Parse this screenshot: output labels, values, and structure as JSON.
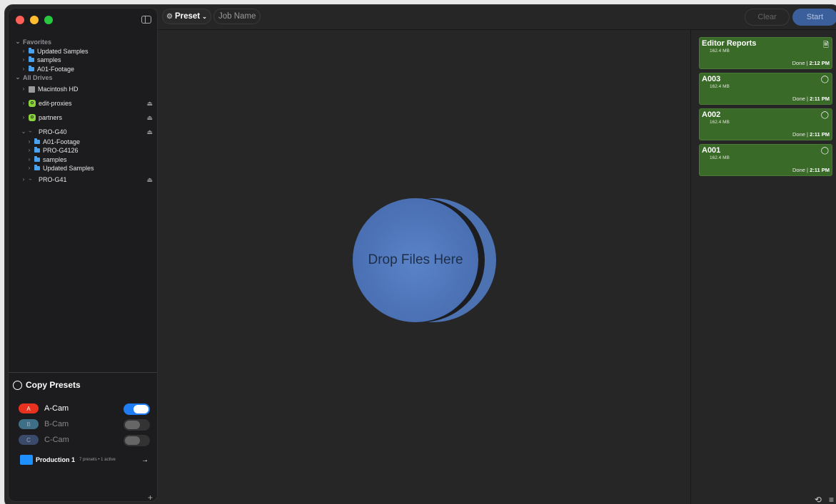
{
  "sidebar": {
    "favorites_label": "Favorites",
    "favorites": [
      "Updated Samples",
      "samples",
      "A01-Footage"
    ],
    "all_drives_label": "All Drives",
    "drives": {
      "macintosh": "Macintosh HD",
      "edit_proxies": "edit-proxies",
      "partners": "partners",
      "pro_g40": "PRO-G40",
      "pro_g40_children": [
        "A01-Footage",
        "PRO-G4126",
        "samples",
        "Updated Samples"
      ],
      "pro_g41": "PRO-G41"
    }
  },
  "presets": {
    "title": "Copy Presets",
    "cams": [
      {
        "badge": "A",
        "label": "A-Cam",
        "color": "#e8321f",
        "on": true
      },
      {
        "badge": "B",
        "label": "B-Cam",
        "color": "#3f6f86",
        "on": false
      },
      {
        "badge": "C",
        "label": "C-Cam",
        "color": "#3a4a6a",
        "on": false
      }
    ],
    "production": {
      "name": "Production 1",
      "meta": "7 presets • 1 active"
    }
  },
  "toolbar": {
    "preset_label": "Preset",
    "job_name_placeholder": "Job Name",
    "clear_label": "Clear",
    "start_label": "Start"
  },
  "drop_zone": {
    "label": "Drop Files Here"
  },
  "jobs": [
    {
      "name": "Editor Reports",
      "size": "162.4 MB",
      "status": "Done",
      "time": "2:12 PM",
      "icon": "document-icon"
    },
    {
      "name": "A003",
      "size": "162.4 MB",
      "status": "Done",
      "time": "2:11 PM",
      "icon": "circle-icon"
    },
    {
      "name": "A002",
      "size": "162.4 MB",
      "status": "Done",
      "time": "2:11 PM",
      "icon": "circle-icon"
    },
    {
      "name": "A001",
      "size": "162.4 MB",
      "status": "Done",
      "time": "2:11 PM",
      "icon": "circle-icon"
    }
  ],
  "colors": {
    "accent": "#3b5f9a",
    "job_card": "#3a6a28",
    "toggle_on": "#1e7cf5"
  }
}
